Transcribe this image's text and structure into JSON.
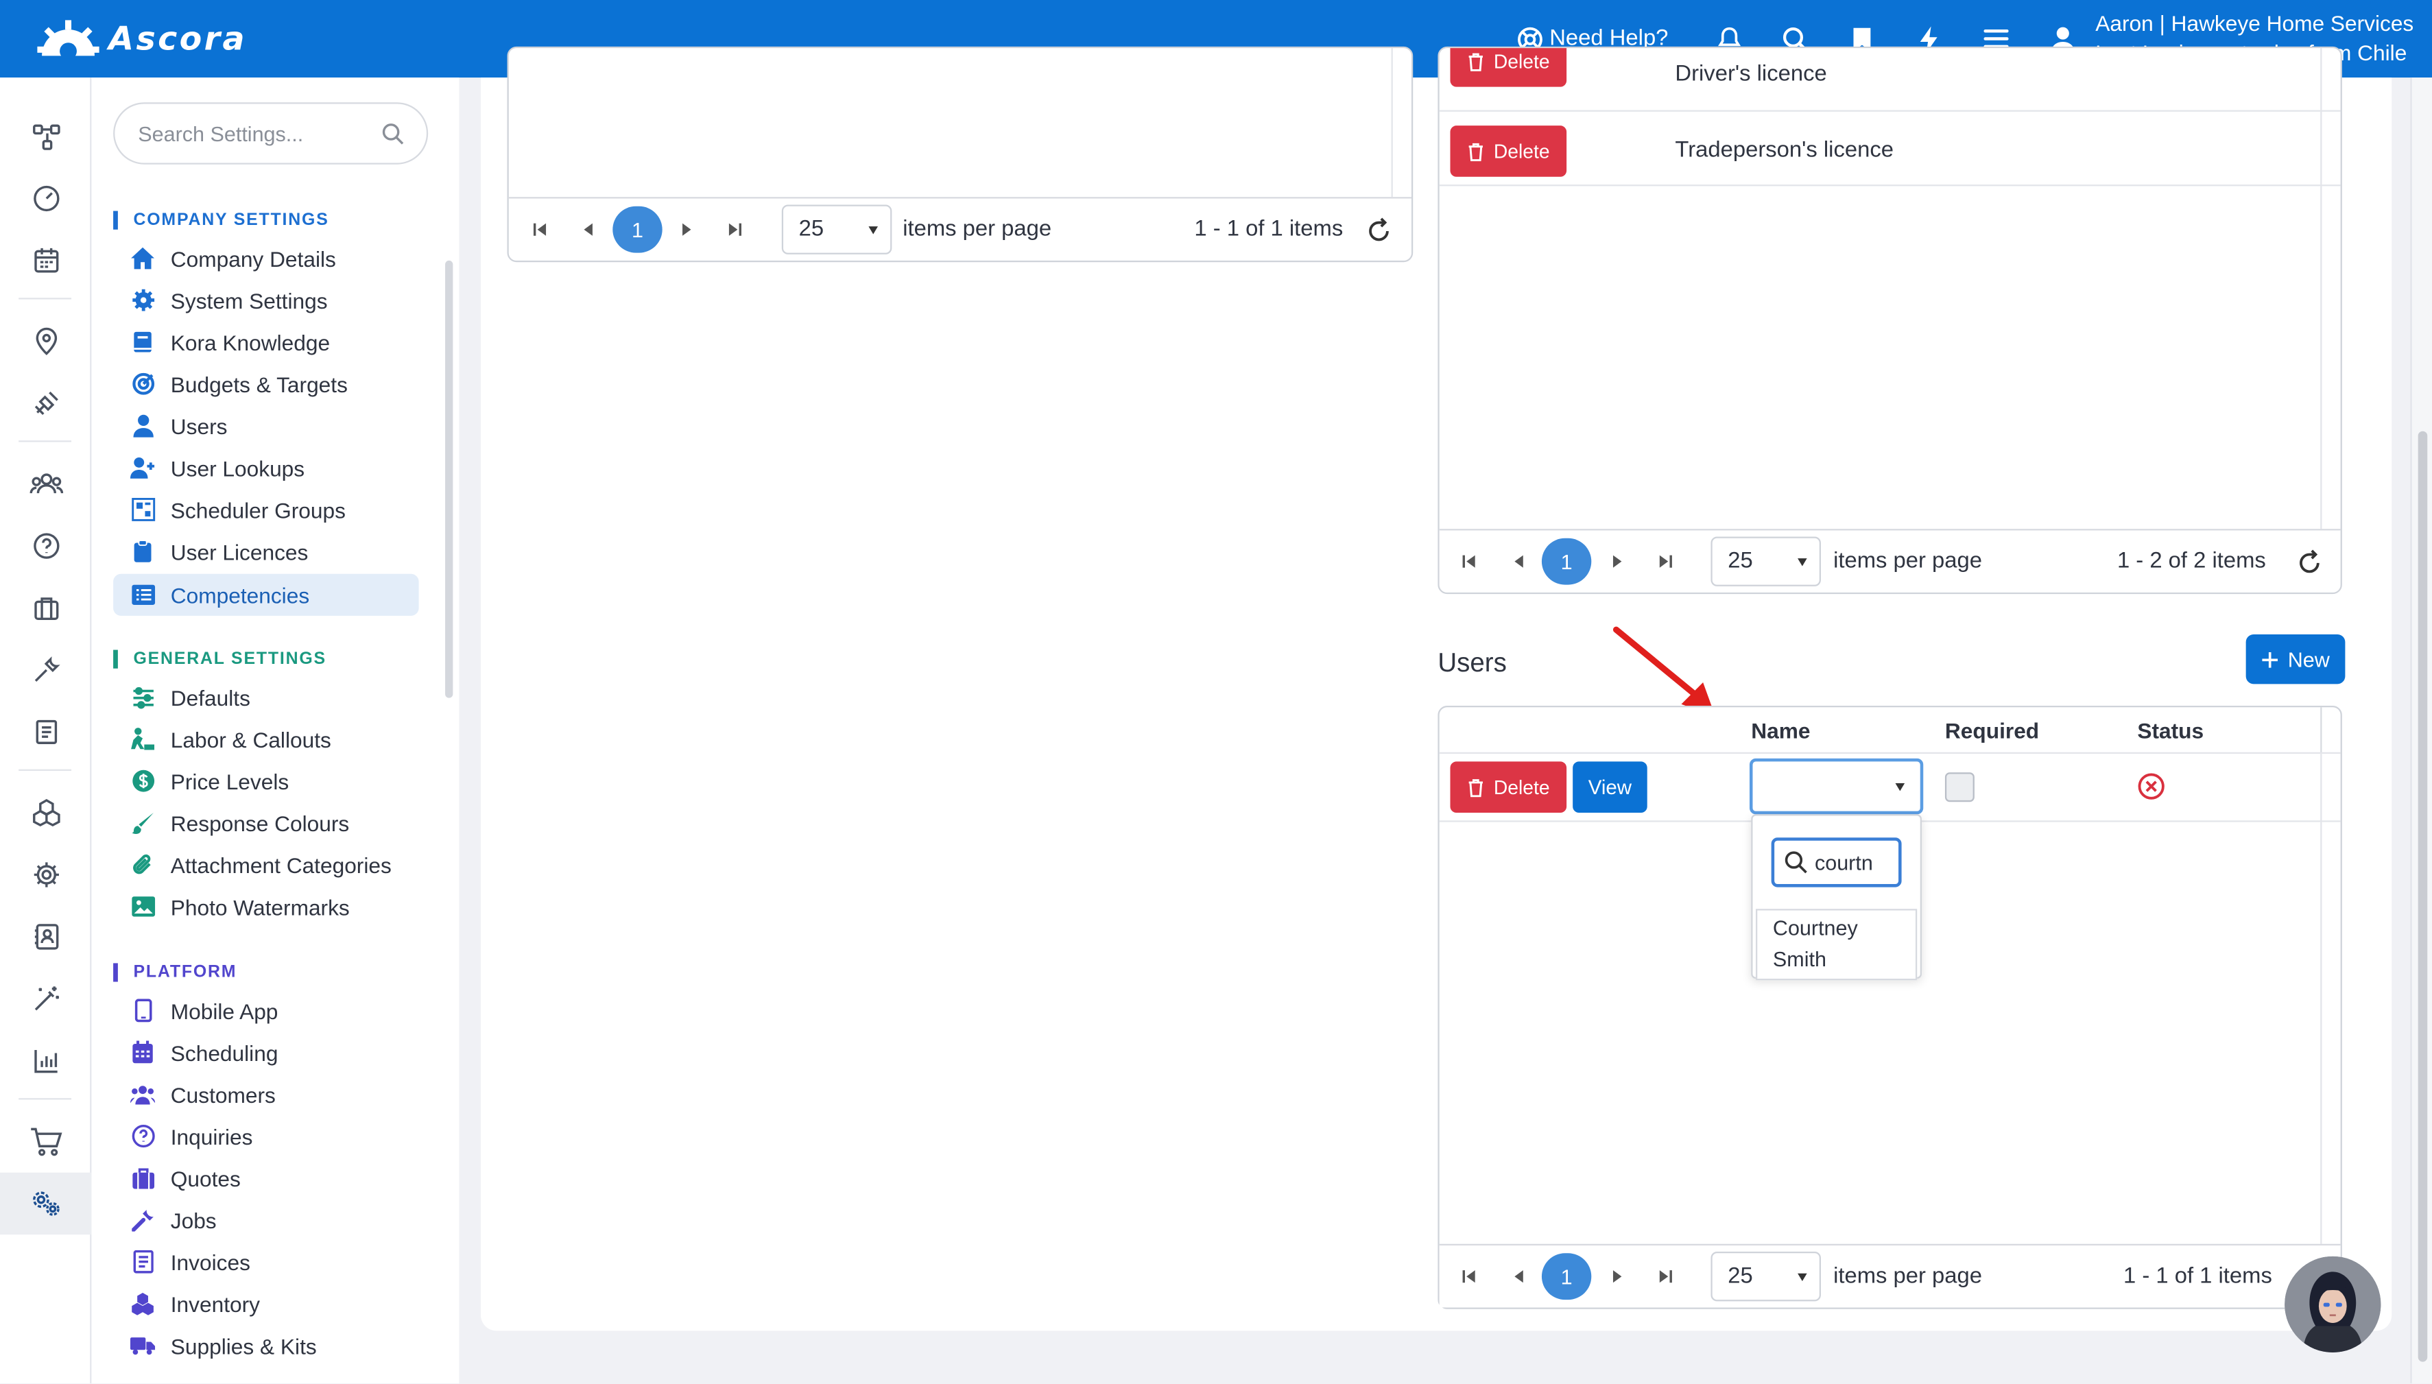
{
  "topbar": {
    "brand": "Ascora",
    "help_label": "Need Help?",
    "user_line1": "Aaron | Hawkeye Home Services",
    "user_line2": "Last Login: yesterday from Chile",
    "bg_color": "#0b72d4"
  },
  "rail": {
    "icons": [
      "workflow-icon",
      "dashboard-icon",
      "calendar-icon",
      "location-icon",
      "dispatch-icon",
      "team-icon",
      "help-icon",
      "briefcase-icon",
      "wrench-icon",
      "document-icon",
      "inventory-icon",
      "settings-icon",
      "contacts-icon",
      "magic-icon",
      "reports-icon",
      "cart-icon",
      "admin-settings-icon"
    ],
    "active": "admin-settings-icon"
  },
  "settings_menu": {
    "search_placeholder": "Search Settings...",
    "sections": [
      {
        "title": "COMPANY SETTINGS",
        "color": "#1d6fd1",
        "items": [
          "Company Details",
          "System Settings",
          "Kora Knowledge",
          "Budgets & Targets",
          "Users",
          "User Lookups",
          "Scheduler Groups",
          "User Licences",
          "Competencies"
        ]
      },
      {
        "title": "GENERAL SETTINGS",
        "color": "#1a9980",
        "items": [
          "Defaults",
          "Labor & Callouts",
          "Price Levels",
          "Response Colours",
          "Attachment Categories",
          "Photo Watermarks"
        ]
      },
      {
        "title": "PLATFORM",
        "color": "#5145cd",
        "items": [
          "Mobile App",
          "Scheduling",
          "Customers",
          "Inquiries",
          "Quotes",
          "Jobs",
          "Invoices",
          "Inventory",
          "Supplies & Kits"
        ]
      }
    ],
    "active_item": "Competencies"
  },
  "left_panel": {
    "pager": {
      "page": "1",
      "page_size": "25",
      "items_per_page_label": "items per page",
      "summary": "1 - 1 of 1 items"
    }
  },
  "licences_panel": {
    "rows": [
      {
        "delete_label": "Delete",
        "name": "Driver's licence"
      },
      {
        "delete_label": "Delete",
        "name": "Tradeperson's licence"
      }
    ],
    "pager": {
      "page": "1",
      "page_size": "25",
      "items_per_page_label": "items per page",
      "summary": "1 - 2 of 2 items"
    }
  },
  "users_panel": {
    "title": "Users",
    "new_label": "New",
    "columns": {
      "name": "Name",
      "required": "Required",
      "status": "Status"
    },
    "row": {
      "delete_label": "Delete",
      "view_label": "View",
      "name_value": "",
      "required": false,
      "status": "inactive"
    },
    "dropdown": {
      "filter_value": "courtn",
      "options": [
        "Courtney Smith"
      ]
    },
    "pager": {
      "page": "1",
      "page_size": "25",
      "items_per_page_label": "items per page",
      "summary": "1 - 1 of 1 items"
    }
  },
  "colors": {
    "primary": "#0b72d4",
    "danger": "#dc3545",
    "page_active": "#3d8ad9",
    "status_error": "#d9303e",
    "annotation_arrow": "#e0201d"
  }
}
